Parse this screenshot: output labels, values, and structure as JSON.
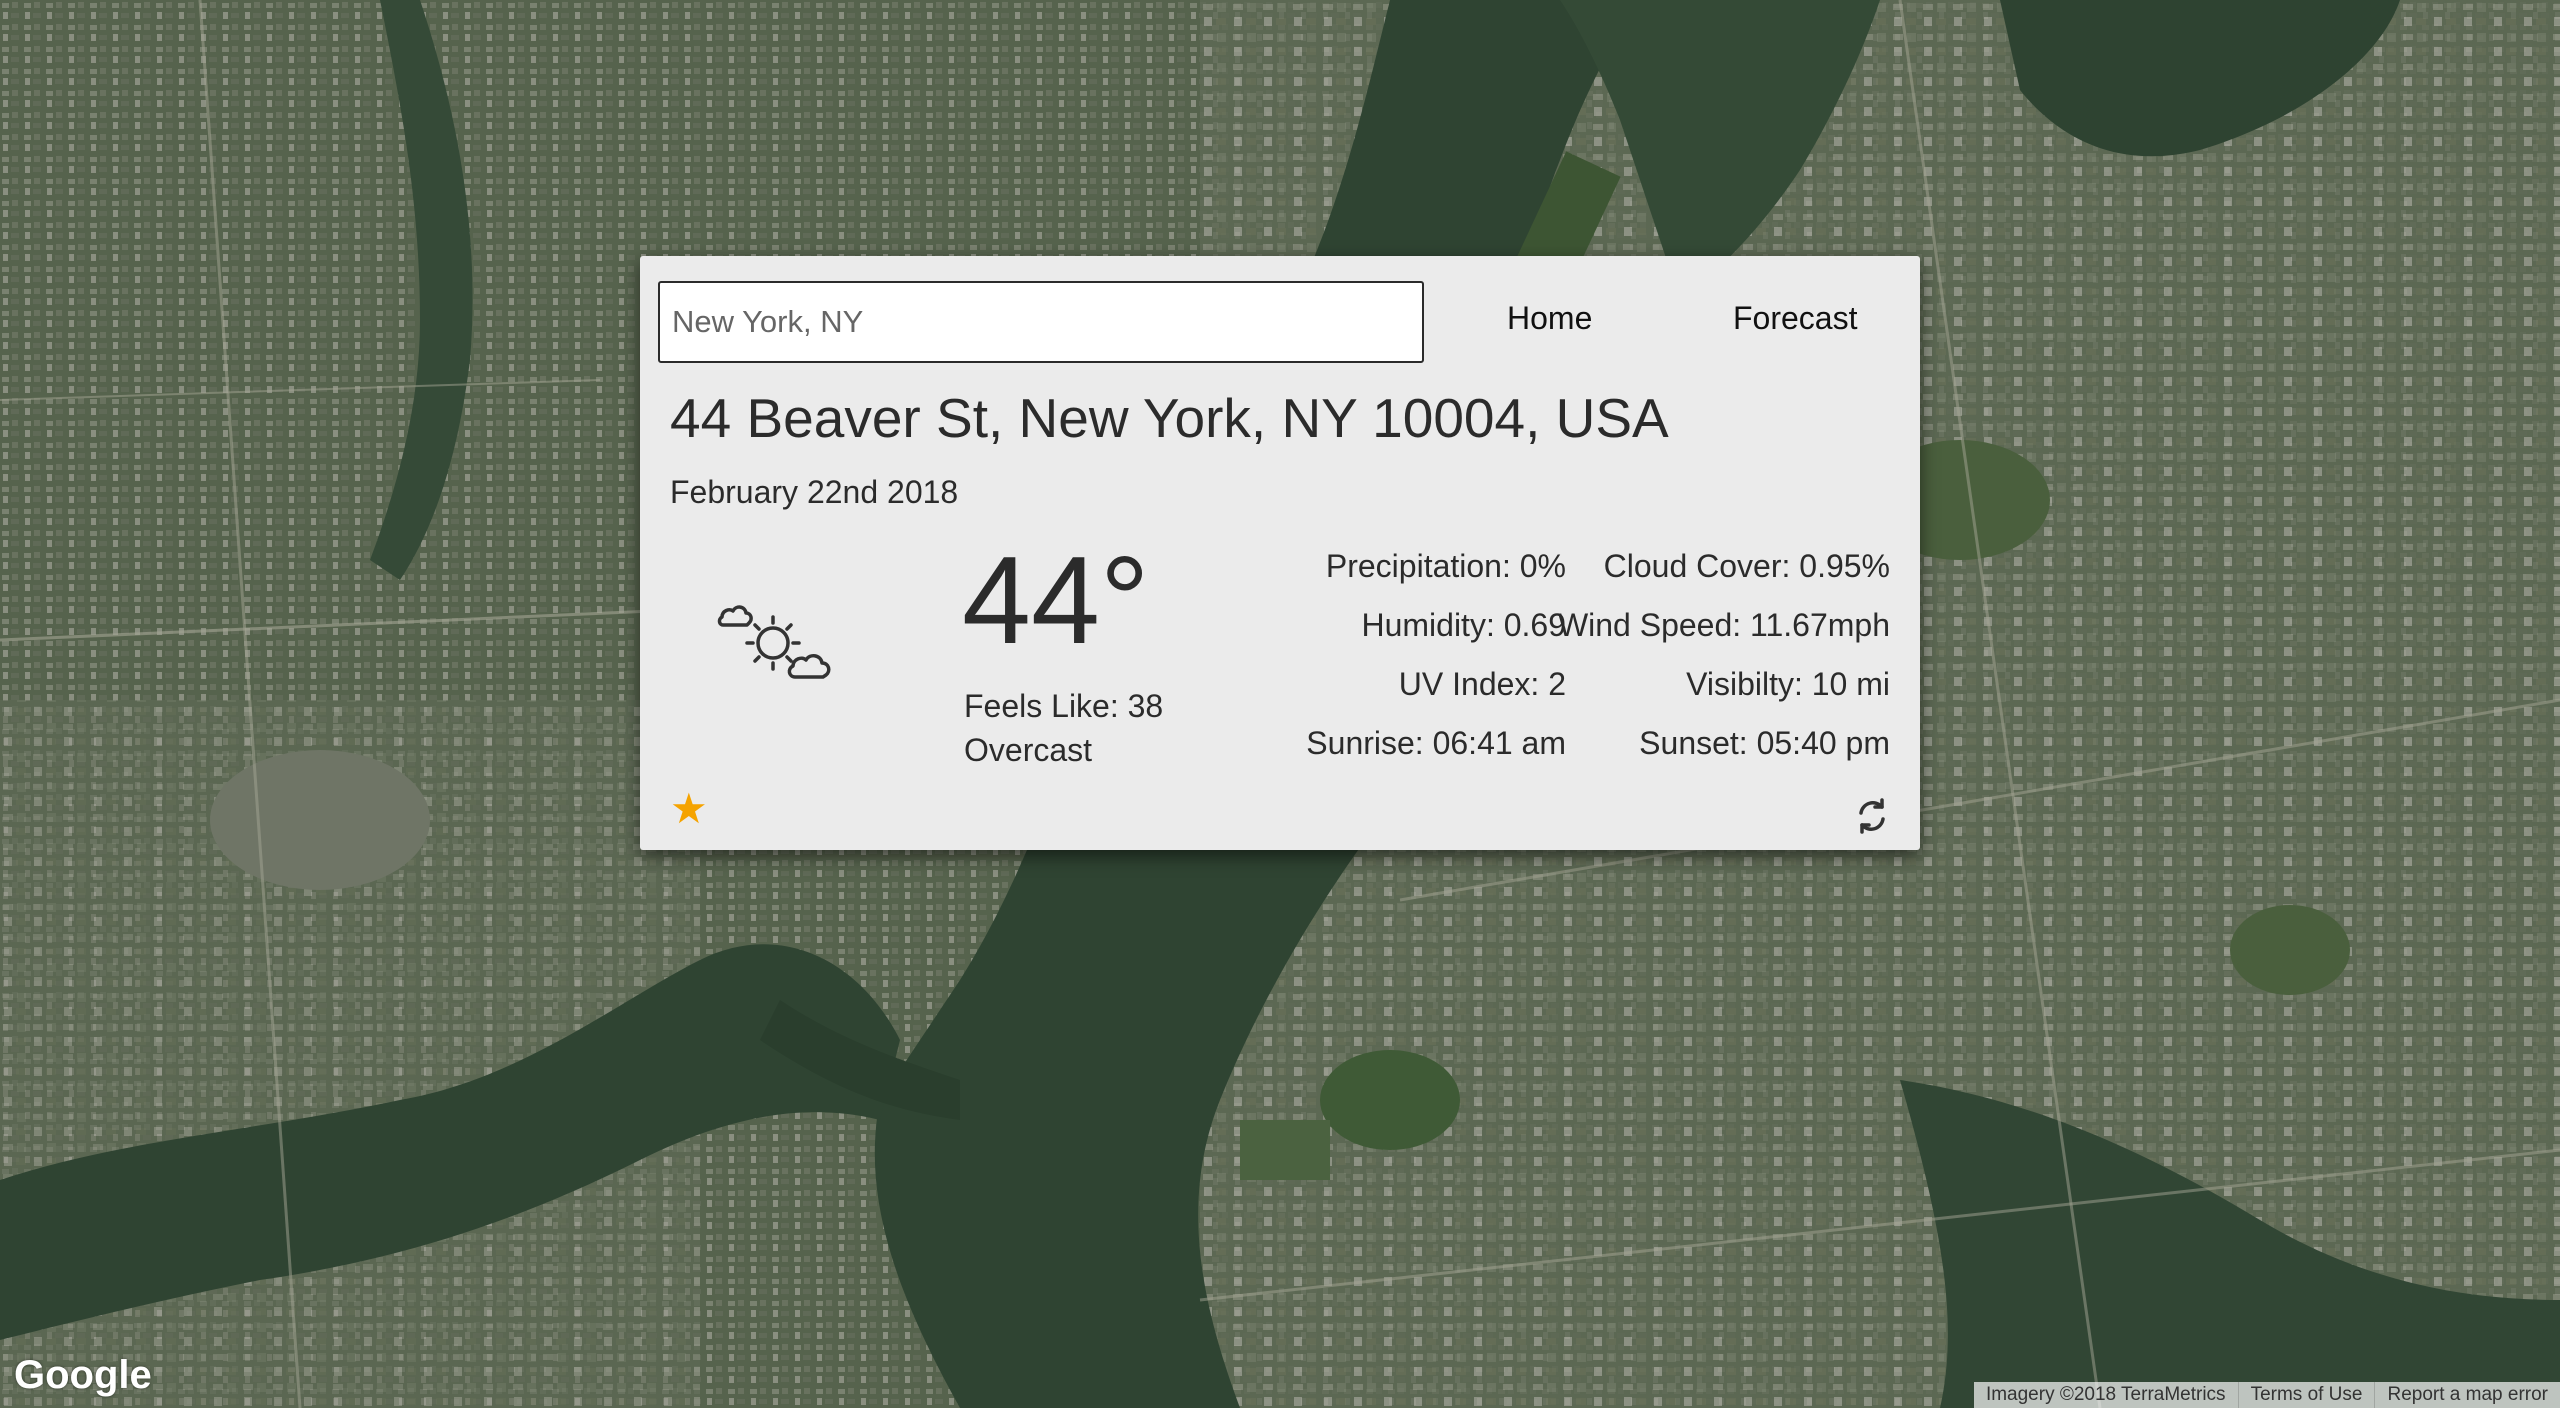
{
  "search": {
    "placeholder": "New York, NY"
  },
  "nav": {
    "home": "Home",
    "forecast": "Forecast"
  },
  "location": {
    "address": "44 Beaver St, New York, NY 10004, USA",
    "date": "February 22nd 2018"
  },
  "current": {
    "icon": "partly-cloudy-sun-icon",
    "temperature": "44°",
    "feels_like": "Feels Like: 38",
    "summary": "Overcast"
  },
  "details_left": [
    "Precipitation: 0%",
    "Humidity: 0.69",
    "UV Index: 2",
    "Sunrise: 06:41 am"
  ],
  "details_right": [
    "Cloud Cover: 0.95%",
    "Wind Speed: 11.67mph",
    "Visibilty: 10 mi",
    "Sunset: 05:40 pm"
  ],
  "actions": {
    "favorite_icon": "star-icon",
    "refresh_icon": "refresh-icon"
  },
  "map": {
    "logo": "Google",
    "footer": [
      "Imagery ©2018 TerraMetrics",
      "Terms of Use",
      "Report a map error"
    ]
  },
  "colors": {
    "card_background": "#ebebeb",
    "star": "#f5a300",
    "text": "#2b2b2b"
  }
}
